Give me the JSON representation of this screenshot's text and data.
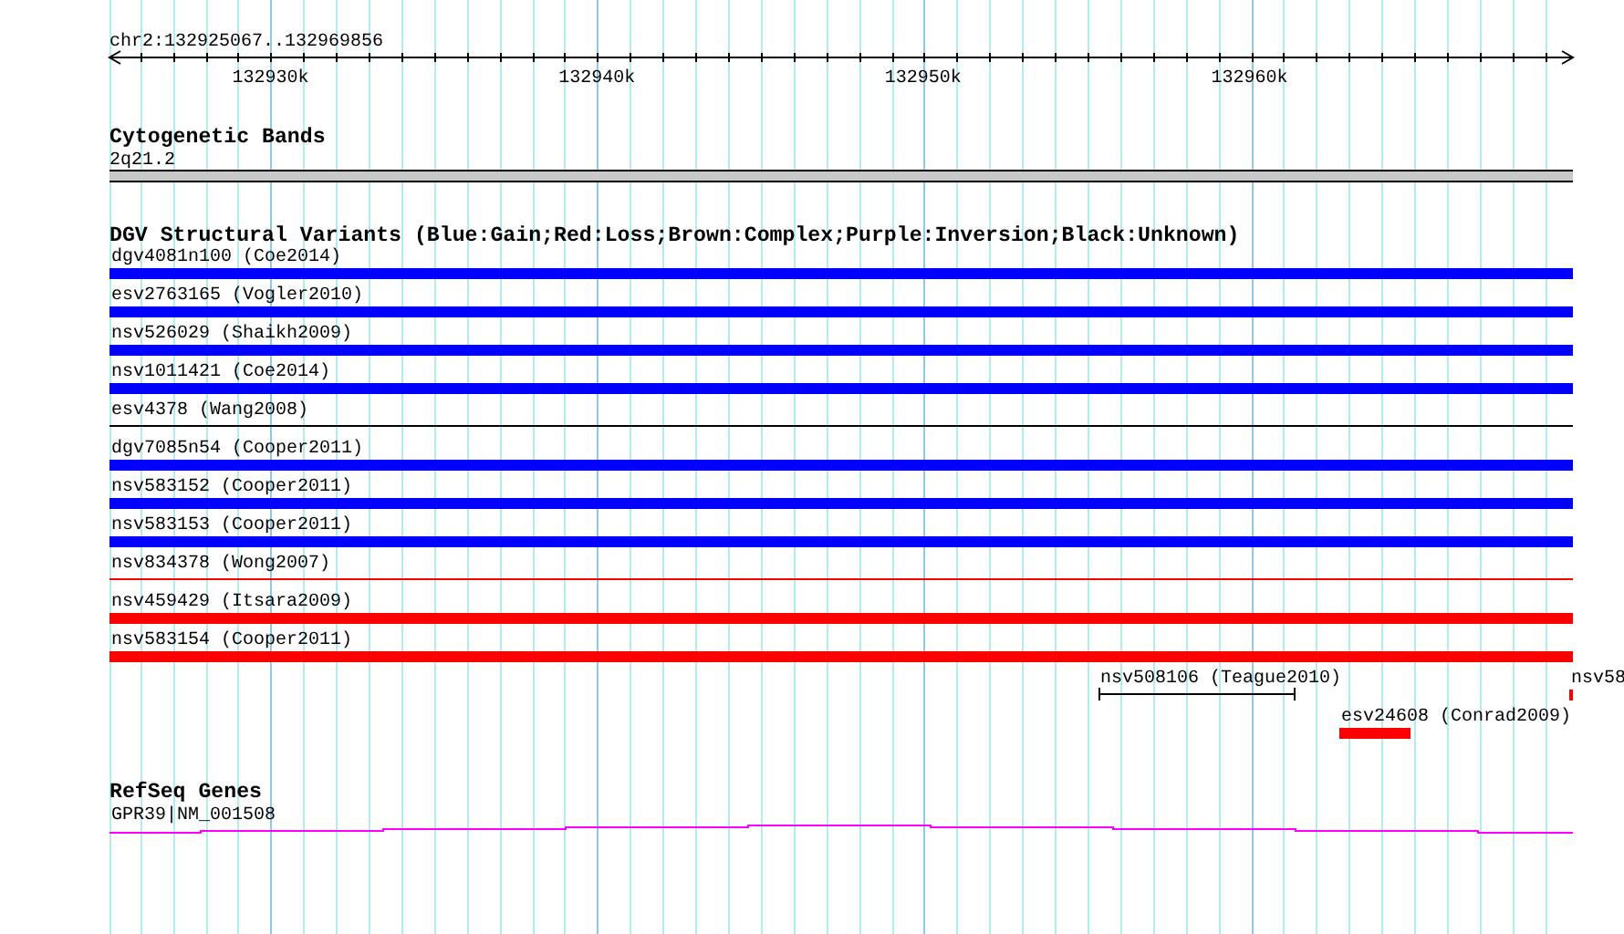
{
  "ruler": {
    "range": "chr2:132925067..132969856",
    "ticks": [
      {
        "label": "132930k"
      },
      {
        "label": "132940k"
      },
      {
        "label": "132950k"
      },
      {
        "label": "132960k"
      }
    ]
  },
  "cytogenetic_bands": {
    "title": "Cytogenetic Bands",
    "band": "2q21.2"
  },
  "dgv_track": {
    "title": "DGV Structural Variants (Blue:Gain;Red:Loss;Brown:Complex;Purple:Inversion;Black:Unknown)",
    "rows": [
      {
        "features": [
          {
            "label": "dgv4081n100 (Coe2014)",
            "kind": "bar",
            "color": "#0000ff"
          }
        ]
      },
      {
        "features": [
          {
            "label": "esv2763165 (Vogler2010)",
            "kind": "bar",
            "color": "#0000ff"
          }
        ]
      },
      {
        "features": [
          {
            "label": "nsv526029 (Shaikh2009)",
            "kind": "bar",
            "color": "#0000ff"
          }
        ]
      },
      {
        "features": [
          {
            "label": "nsv1011421 (Coe2014)",
            "kind": "bar",
            "color": "#0000ff"
          }
        ]
      },
      {
        "features": [
          {
            "label": "esv4378 (Wang2008)",
            "kind": "line",
            "color": "#000000"
          }
        ]
      },
      {
        "features": [
          {
            "label": "dgv7085n54 (Cooper2011)",
            "kind": "bar",
            "color": "#0000ff"
          }
        ]
      },
      {
        "features": [
          {
            "label": "nsv583152 (Cooper2011)",
            "kind": "bar",
            "color": "#0000ff"
          }
        ]
      },
      {
        "features": [
          {
            "label": "nsv583153 (Cooper2011)",
            "kind": "bar",
            "color": "#0000ff"
          }
        ]
      },
      {
        "features": [
          {
            "label": "nsv834378 (Wong2007)",
            "kind": "line",
            "color": "#ff0000"
          }
        ]
      },
      {
        "features": [
          {
            "label": "nsv459429 (Itsara2009)",
            "kind": "bar",
            "color": "#ff0000"
          }
        ]
      },
      {
        "features": [
          {
            "label": "nsv583154 (Cooper2011)",
            "kind": "bar",
            "color": "#ff0000"
          }
        ]
      },
      {
        "features": [
          {
            "label": "nsv508106 (Teague2010)",
            "kind": "span",
            "color": "#000000"
          },
          {
            "label": "nsv58",
            "kind": "bar",
            "color": "#ff0000"
          }
        ]
      },
      {
        "features": [
          {
            "label": "esv24608 (Conrad2009)",
            "kind": "bar",
            "color": "#ff0000"
          }
        ]
      }
    ]
  },
  "refseq_genes": {
    "title": "RefSeq Genes",
    "gene": "GPR39|NM_001508"
  }
}
